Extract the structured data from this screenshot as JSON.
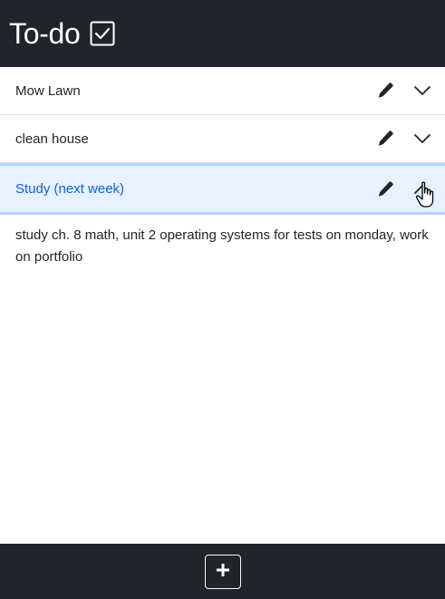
{
  "header": {
    "title": "To-do",
    "title_icon": "check-square-icon"
  },
  "todos": [
    {
      "label": "Mow Lawn",
      "expanded": false
    },
    {
      "label": "clean house",
      "expanded": false
    },
    {
      "label": "Study (next week)",
      "expanded": true,
      "detail": "study ch. 8 math, unit 2 operating systems for tests on monday, work on portfolio"
    }
  ],
  "footer": {
    "add_icon": "plus-icon"
  },
  "colors": {
    "header_bg": "#212529",
    "active_bg": "#e7f1ff",
    "active_text": "#0c63e4",
    "active_border": "#b6d4fe"
  }
}
